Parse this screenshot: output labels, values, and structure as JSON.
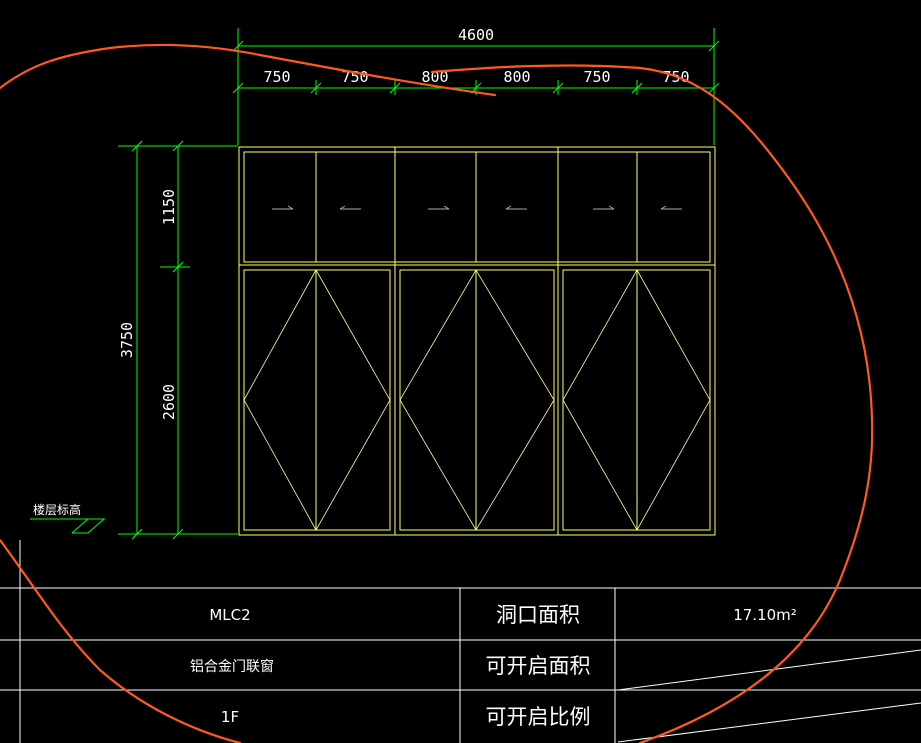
{
  "dimensions": {
    "total_width": "4600",
    "widths": [
      "750",
      "750",
      "800",
      "800",
      "750",
      "750"
    ],
    "total_height": "3750",
    "upper_height": "1150",
    "lower_height": "2600"
  },
  "floor_level_label": "楼层标高",
  "title_table": {
    "code": "MLC2",
    "opening_area_label": "洞口面积",
    "opening_area_value": "17.10m²",
    "type_name": "铝合金门联窗",
    "openable_area_label": "可开启面积",
    "floor": "1F",
    "openable_ratio_label": "可开启比例"
  },
  "colors": {
    "background": "#000000",
    "dimension": "#00ff00",
    "frame": "#ffff66",
    "table_lines": "#ffffff",
    "markup": "#ff5a1e"
  },
  "icons": {
    "arrows": [
      "arrow-right-icon",
      "arrow-left-icon",
      "arrow-right-icon",
      "arrow-left-icon",
      "arrow-right-icon",
      "arrow-left-icon"
    ]
  }
}
